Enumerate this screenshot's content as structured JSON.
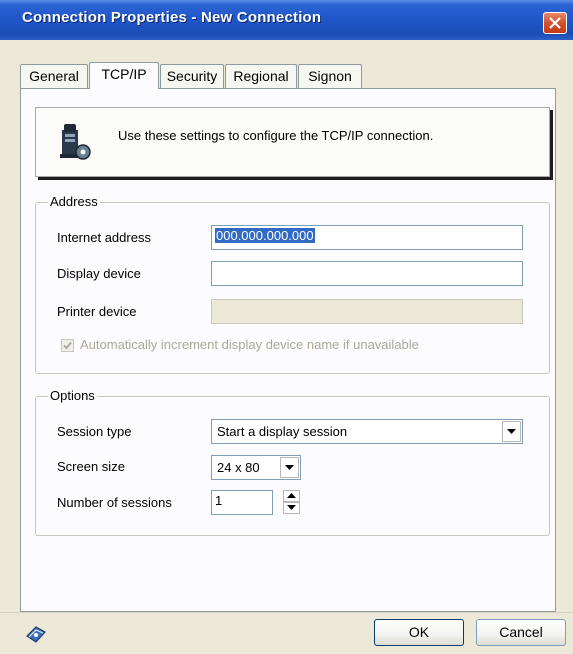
{
  "window": {
    "title": "Connection Properties - New Connection"
  },
  "tabs": [
    {
      "label": "General"
    },
    {
      "label": "TCP/IP"
    },
    {
      "label": "Security"
    },
    {
      "label": "Regional"
    },
    {
      "label": "Signon"
    }
  ],
  "active_tab": "TCP/IP",
  "info": {
    "text": "Use these settings to configure the TCP/IP connection.",
    "icon": "computer-gear-icon"
  },
  "address": {
    "group_label": "Address",
    "internet_address": {
      "label": "Internet address",
      "value": "000.000.000.000"
    },
    "display_device": {
      "label": "Display device",
      "value": ""
    },
    "printer_device": {
      "label": "Printer device",
      "value": ""
    },
    "auto_increment": {
      "label": "Automatically increment display device name if unavailable",
      "checked": true,
      "enabled": false
    }
  },
  "options": {
    "group_label": "Options",
    "session_type": {
      "label": "Session type",
      "value": "Start a display session"
    },
    "screen_size": {
      "label": "Screen size",
      "value": "24 x 80"
    },
    "num_sessions": {
      "label": "Number of sessions",
      "value": "1"
    }
  },
  "buttons": {
    "ok": "OK",
    "cancel": "Cancel"
  },
  "colors": {
    "titlebar": "#1f55c6",
    "selection": "#316ac5",
    "close_button": "#d4512c"
  }
}
